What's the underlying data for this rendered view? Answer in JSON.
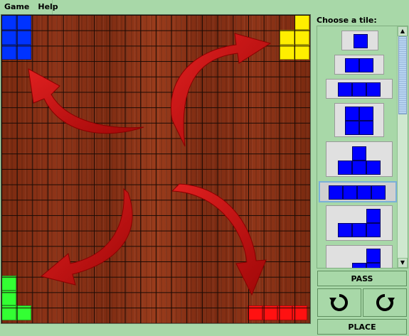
{
  "menu": {
    "game": "Game",
    "help": "Help"
  },
  "board": {
    "grid_size": 20,
    "players": [
      {
        "color_name": "blue",
        "color": "#0033ff",
        "corner": "top-left"
      },
      {
        "color_name": "yellow",
        "color": "#ffee00",
        "corner": "top-right"
      },
      {
        "color_name": "green",
        "color": "#33ff33",
        "corner": "bottom-left"
      },
      {
        "color_name": "red",
        "color": "#ff1111",
        "corner": "bottom-right"
      }
    ],
    "arrow_color": "#cc1111"
  },
  "side": {
    "title": "Choose a tile:",
    "tile_color": "#0000ff",
    "tiles": [
      {
        "name": "monomino"
      },
      {
        "name": "domino"
      },
      {
        "name": "tromino-I"
      },
      {
        "name": "tetromino-O"
      },
      {
        "name": "tetromino-T"
      },
      {
        "name": "tetromino-I"
      },
      {
        "name": "tetromino-L"
      },
      {
        "name": "pentomino"
      }
    ]
  },
  "buttons": {
    "pass": "PASS",
    "place": "PLACE",
    "rotate_left_icon": "rotate-counterclockwise-icon",
    "rotate_right_icon": "rotate-clockwise-icon"
  }
}
